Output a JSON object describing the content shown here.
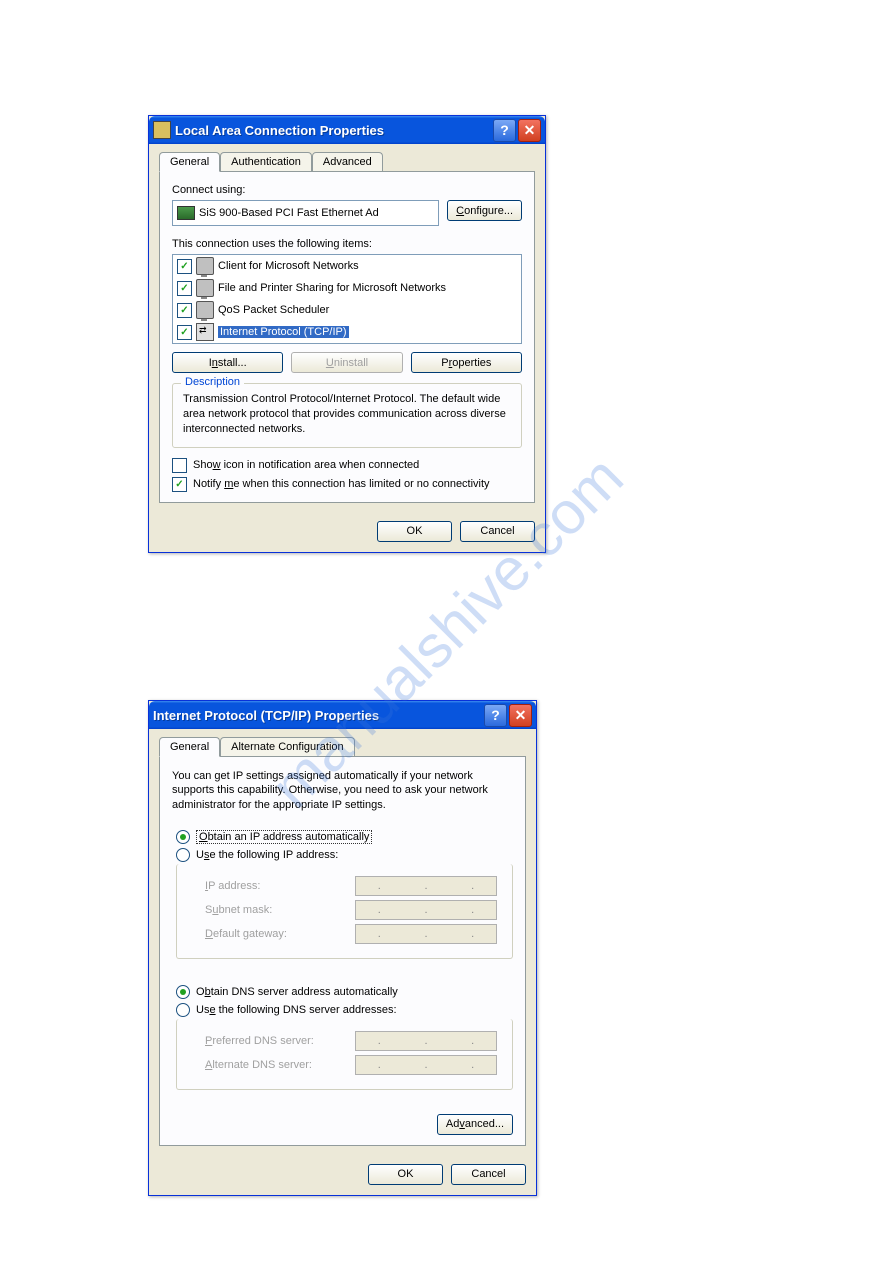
{
  "watermark": "manualshive.com",
  "dialog1": {
    "title": "Local Area Connection Properties",
    "tabs": [
      "General",
      "Authentication",
      "Advanced"
    ],
    "connect_label": "Connect using:",
    "adapter": "SiS 900-Based PCI Fast Ethernet Ad",
    "configure_btn": "Configure...",
    "items_label": "This connection uses the following items:",
    "items": [
      {
        "checked": true,
        "label": "Client for Microsoft Networks",
        "selected": false
      },
      {
        "checked": true,
        "label": "File and Printer Sharing for Microsoft Networks",
        "selected": false
      },
      {
        "checked": true,
        "label": "QoS Packet Scheduler",
        "selected": false
      },
      {
        "checked": true,
        "label": "Internet Protocol (TCP/IP)",
        "selected": true
      }
    ],
    "install_btn": "Install...",
    "uninstall_btn": "Uninstall",
    "properties_btn": "Properties",
    "desc_legend": "Description",
    "desc_text": "Transmission Control Protocol/Internet Protocol. The default wide area network protocol that provides communication across diverse interconnected networks.",
    "show_icon": "Show icon in notification area when connected",
    "notify": "Notify me when this connection has limited or no connectivity",
    "ok": "OK",
    "cancel": "Cancel"
  },
  "dialog2": {
    "title": "Internet Protocol (TCP/IP) Properties",
    "tabs": [
      "General",
      "Alternate Configuration"
    ],
    "intro": "You can get IP settings assigned automatically if your network supports this capability. Otherwise, you need to ask your network administrator for the appropriate IP settings.",
    "radio_auto_ip": "Obtain an IP address automatically",
    "radio_manual_ip": "Use the following IP address:",
    "ip_label": "IP address:",
    "subnet_label": "Subnet mask:",
    "gateway_label": "Default gateway:",
    "radio_auto_dns": "Obtain DNS server address automatically",
    "radio_manual_dns": "Use the following DNS server addresses:",
    "pref_dns": "Preferred DNS server:",
    "alt_dns": "Alternate DNS server:",
    "advanced_btn": "Advanced...",
    "ok": "OK",
    "cancel": "Cancel"
  }
}
